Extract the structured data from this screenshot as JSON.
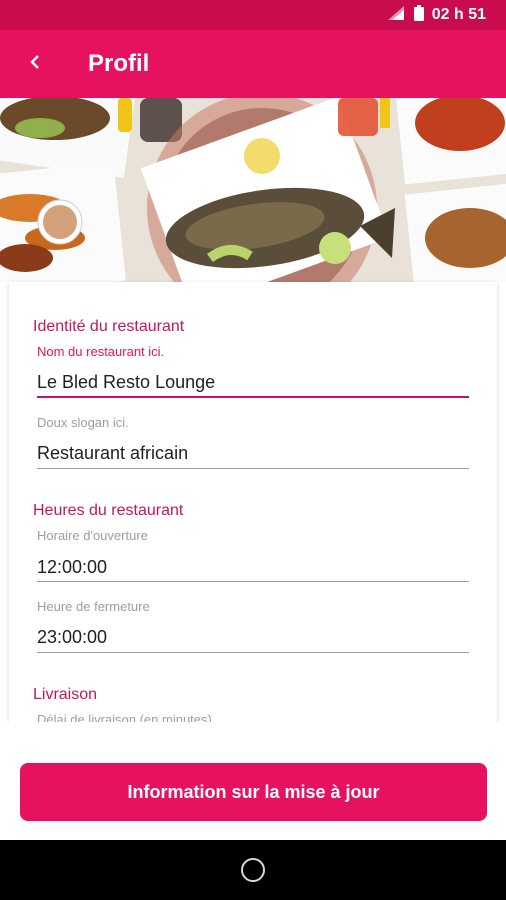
{
  "status_bar": {
    "time": "02 h 51"
  },
  "app_bar": {
    "title": "Profil"
  },
  "form": {
    "identity": {
      "title": "Identité du restaurant",
      "name_label": "Nom du restaurant ici.",
      "name_value": "Le Bled Resto Lounge",
      "slogan_label": "Doux slogan ici.",
      "slogan_value": "Restaurant africain"
    },
    "hours": {
      "title": "Heures du restaurant",
      "opening_label": "Horaire d'ouverture",
      "opening_value": "12:00:00",
      "closing_label": "Heure de fermeture",
      "closing_value": "23:00:00"
    },
    "delivery": {
      "title": "Livraison",
      "delay_label": "Délai de livraison (en minutes)"
    }
  },
  "actions": {
    "update_label": "Information sur la mise à jour"
  },
  "colors": {
    "primary": "#e6125f",
    "status": "#c90c4e",
    "accent_text": "#c2185b"
  }
}
